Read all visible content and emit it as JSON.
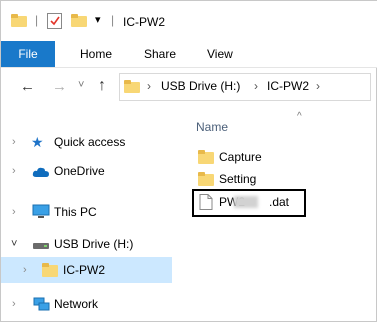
{
  "titlebar": {
    "title": "IC-PW2",
    "quick_access_dropdown": "▾",
    "separator": "|"
  },
  "ribbon": {
    "tabs": [
      "File",
      "Home",
      "Share",
      "View"
    ]
  },
  "navigation": {
    "back": "←",
    "forward": "→",
    "recent": "˅",
    "up": "↑",
    "breadcrumb": [
      "USB Drive (H:)",
      "IC-PW2"
    ],
    "sep": "›"
  },
  "sidebar": {
    "items": [
      {
        "label": "Quick access",
        "icon": "star-icon",
        "expander": "›"
      },
      {
        "label": "OneDrive",
        "icon": "cloud-icon",
        "expander": "›"
      },
      {
        "label": "This PC",
        "icon": "monitor-icon",
        "expander": "›"
      },
      {
        "label": "USB Drive (H:)",
        "icon": "drive-icon",
        "expander": "˅"
      },
      {
        "label": "IC-PW2",
        "icon": "folder-icon",
        "expander": "›",
        "selected": true
      },
      {
        "label": "Network",
        "icon": "network-icon",
        "expander": "›"
      }
    ]
  },
  "content": {
    "column_header": "Name",
    "sort_indicator": "^",
    "files": [
      {
        "name": "Capture",
        "type": "folder"
      },
      {
        "name": "Setting",
        "type": "folder"
      },
      {
        "name_prefix": "PW2",
        "name_suffix": ".dat",
        "type": "file"
      }
    ]
  },
  "colors": {
    "file_tab": "#1979ca",
    "selection": "#cce8ff",
    "folder": "#f8d775"
  }
}
